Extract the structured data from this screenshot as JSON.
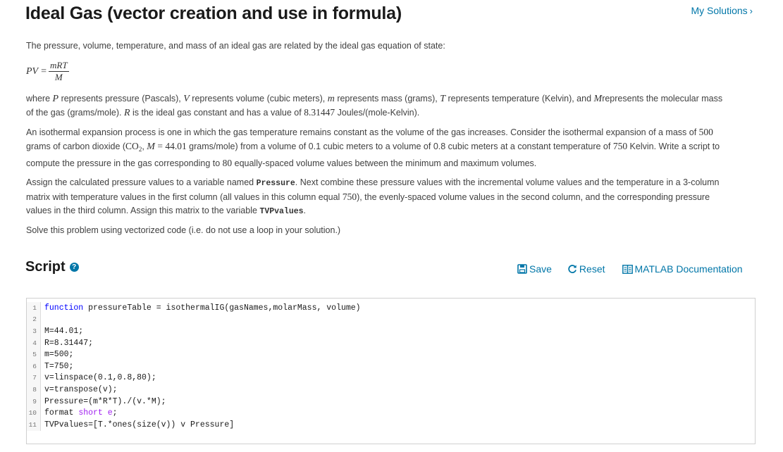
{
  "header": {
    "title": "Ideal Gas (vector creation and use in formula)",
    "my_solutions": "My Solutions",
    "my_solutions_chevron": "›"
  },
  "problem": {
    "intro": "The pressure, volume, temperature, and mass of an ideal gas are related by the ideal gas equation of state:",
    "equation": {
      "lhs": "PV",
      "eq": "=",
      "numerator": "mRT",
      "denominator": "M"
    },
    "p2": {
      "a": "where ",
      "P": "P",
      "b": " represents pressure (Pascals), ",
      "V": "V",
      "c": " represents volume (cubic meters), ",
      "m": "m",
      "d": " represents mass (grams), ",
      "T": "T",
      "e": " represents temperature (Kelvin), and ",
      "M": "M",
      "f": "represents the molecular mass of the gas (grams/mole).  ",
      "R": "R",
      "g": " is the ideal gas constant and has a value of ",
      "Rval": "8.31447",
      "h": " Joules/(mole-Kelvin)."
    },
    "p3": {
      "a": "An isothermal expansion process is one in which the gas temperature remains constant as the volume of the gas increases.  Consider the isothermal expansion of a mass of ",
      "mass": "500",
      "b": " grams of carbon dioxide (",
      "co": "CO",
      "co_sub": "2",
      "comma": ", ",
      "M": "M",
      "eq": " = ",
      "mval": "44.01",
      "c": " grams/mole) from a volume of 0.1 cubic meters to a volume of 0.8 cubic meters at a constant temperature of ",
      "temp": "750",
      "d": " Kelvin.  Write a script to compute the pressure in the gas corresponding to ",
      "n": "80",
      "e": " equally-spaced volume values between the minimum and maximum volumes."
    },
    "p4": {
      "a": "Assign the calculated pressure values to a variable named ",
      "var1": "Pressure",
      "b": ".  Next combine these pressure values with the incremental volume values and the temperature in a 3-column matrix with temperature values in the first column (all values in this column equal ",
      "temp": "750",
      "c": "), the evenly-spaced volume values in the second column, and the corresponding pressure values in the third column.  Assign this matrix to the variable ",
      "var2": "TVPvalues",
      "d": "."
    },
    "p5": "Solve this problem using vectorized code (i.e. do not use a loop in your solution.)"
  },
  "script": {
    "title": "Script",
    "help_icon": "?",
    "save": "Save",
    "reset": "Reset",
    "docs": "MATLAB Documentation"
  },
  "code_lines": [
    {
      "n": "1",
      "parts": [
        {
          "t": "function",
          "k": "kw"
        },
        {
          "t": " pressureTable = isothermalIG(gasNames,molarMass, volume)"
        }
      ]
    },
    {
      "n": "2",
      "parts": [
        {
          "t": ""
        }
      ]
    },
    {
      "n": "3",
      "parts": [
        {
          "t": "M=44.01;"
        }
      ]
    },
    {
      "n": "4",
      "parts": [
        {
          "t": "R=8.31447;"
        }
      ]
    },
    {
      "n": "5",
      "parts": [
        {
          "t": "m=500;"
        }
      ]
    },
    {
      "n": "6",
      "parts": [
        {
          "t": "T=750;"
        }
      ]
    },
    {
      "n": "7",
      "parts": [
        {
          "t": "v=linspace(0.1,0.8,80);"
        }
      ]
    },
    {
      "n": "8",
      "parts": [
        {
          "t": "v=transpose(v);"
        }
      ]
    },
    {
      "n": "9",
      "parts": [
        {
          "t": "Pressure=(m*R*T)./(v.*M);"
        }
      ]
    },
    {
      "n": "10",
      "parts": [
        {
          "t": "format "
        },
        {
          "t": "short e",
          "k": "str"
        },
        {
          "t": ";"
        }
      ]
    },
    {
      "n": "11",
      "parts": [
        {
          "t": "TVPvalues=[T.*ones(size(v)) v Pressure]"
        }
      ]
    }
  ],
  "colors": {
    "link": "#0076a8",
    "keyword": "#0000ff",
    "string": "#a020f0"
  }
}
